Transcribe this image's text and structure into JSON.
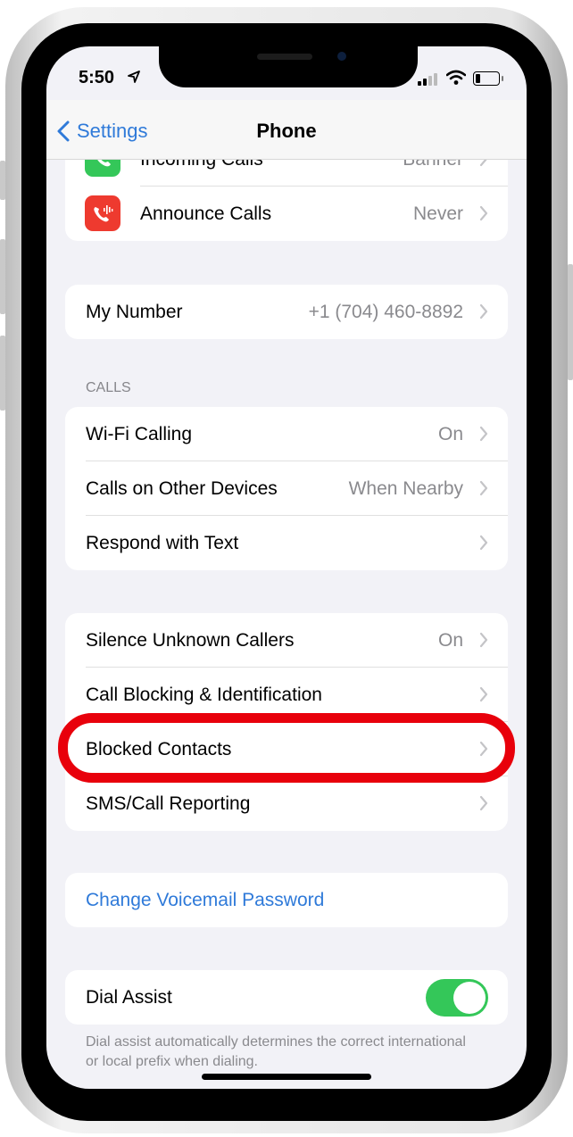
{
  "status_bar": {
    "time": "5:50",
    "location_icon": "location-arrow-icon",
    "signal_icon": "cellular-signal-icon",
    "wifi_icon": "wifi-icon",
    "battery_icon": "battery-low-icon"
  },
  "nav": {
    "back_label": "Settings",
    "title": "Phone"
  },
  "groups": [
    {
      "rows": [
        {
          "label": "Incoming Calls",
          "value": "Banner",
          "icon": "phone-icon",
          "icon_color": "#34c759"
        },
        {
          "label": "Announce Calls",
          "value": "Never",
          "icon": "announce-calls-icon",
          "icon_color": "#ee3a2f"
        }
      ]
    },
    {
      "rows": [
        {
          "label": "My Number",
          "value": "+1 (704) 460-8892"
        }
      ]
    },
    {
      "header": "CALLS",
      "rows": [
        {
          "label": "Wi-Fi Calling",
          "value": "On"
        },
        {
          "label": "Calls on Other Devices",
          "value": "When Nearby"
        },
        {
          "label": "Respond with Text",
          "value": ""
        }
      ]
    },
    {
      "rows": [
        {
          "label": "Silence Unknown Callers",
          "value": "On"
        },
        {
          "label": "Call Blocking & Identification",
          "value": ""
        },
        {
          "label": "Blocked Contacts",
          "value": "",
          "highlighted": true
        },
        {
          "label": "SMS/Call Reporting",
          "value": ""
        }
      ]
    },
    {
      "rows": [
        {
          "label": "Change Voicemail Password",
          "link": true
        }
      ]
    },
    {
      "rows": [
        {
          "label": "Dial Assist",
          "toggle": true,
          "toggle_on": true
        }
      ],
      "footer": "Dial assist automatically determines the correct international or local prefix when dialing."
    }
  ],
  "colors": {
    "accent": "#2f7ad9",
    "toggle_on": "#34c759",
    "highlight": "#e8000b",
    "background": "#f2f2f7"
  }
}
